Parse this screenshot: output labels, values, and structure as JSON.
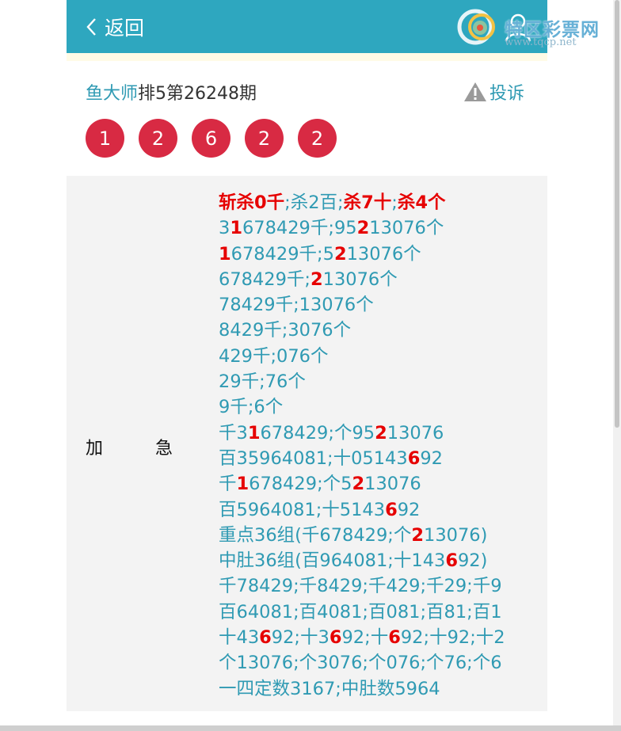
{
  "header": {
    "back_label": "返回"
  },
  "watermark": {
    "text": "特区彩票网",
    "url": "www.tqcp.net"
  },
  "title": {
    "author": "鱼大师",
    "rest": "排5第26248期"
  },
  "complain_label": "投诉",
  "balls": [
    "1",
    "2",
    "6",
    "2",
    "2"
  ],
  "label": {
    "a": "加",
    "b": "急"
  },
  "lines": [
    [
      [
        "斩杀0千",
        1
      ],
      [
        ";杀2百;",
        0
      ],
      [
        "杀7十",
        1
      ],
      [
        ";",
        0
      ],
      [
        "杀4个",
        1
      ]
    ],
    [
      [
        "3",
        0
      ],
      [
        "1",
        1
      ],
      [
        "678429千;95",
        0
      ],
      [
        "2",
        1
      ],
      [
        "13076个",
        0
      ]
    ],
    [
      [
        "1",
        1
      ],
      [
        "678429千;5",
        0
      ],
      [
        "2",
        1
      ],
      [
        "13076个",
        0
      ]
    ],
    [
      [
        "678429千;",
        0
      ],
      [
        "2",
        1
      ],
      [
        "13076个",
        0
      ]
    ],
    [
      [
        "78429千;13076个",
        0
      ]
    ],
    [
      [
        "8429千;3076个",
        0
      ]
    ],
    [
      [
        "429千;076个",
        0
      ]
    ],
    [
      [
        "29千;76个",
        0
      ]
    ],
    [
      [
        "9千;6个",
        0
      ]
    ],
    [
      [
        "千3",
        0
      ],
      [
        "1",
        1
      ],
      [
        "678429;个95",
        0
      ],
      [
        "2",
        1
      ],
      [
        "13076",
        0
      ]
    ],
    [
      [
        "百35964081;十05143",
        0
      ],
      [
        "6",
        1
      ],
      [
        "92",
        0
      ]
    ],
    [
      [
        "千",
        0
      ],
      [
        "1",
        1
      ],
      [
        "678429;个5",
        0
      ],
      [
        "2",
        1
      ],
      [
        "13076",
        0
      ]
    ],
    [
      [
        "百5964081;十5143",
        0
      ],
      [
        "6",
        1
      ],
      [
        "92",
        0
      ]
    ],
    [
      [
        "重点36组(千678429;个",
        0
      ],
      [
        "2",
        1
      ],
      [
        "13076)",
        0
      ]
    ],
    [
      [
        "中肚36组(百964081;十143",
        0
      ],
      [
        "6",
        1
      ],
      [
        "92)",
        0
      ]
    ],
    [
      [
        "千78429;千8429;千429;千29;千9",
        0
      ]
    ],
    [
      [
        "百64081;百4081;百081;百81;百1",
        0
      ]
    ],
    [
      [
        "十43",
        0
      ],
      [
        "6",
        1
      ],
      [
        "92;十3",
        0
      ],
      [
        "6",
        1
      ],
      [
        "92;十",
        0
      ],
      [
        "6",
        1
      ],
      [
        "92;十92;十2",
        0
      ]
    ],
    [
      [
        "个13076;个3076;个076;个76;个6",
        0
      ]
    ],
    [
      [
        "一四定数3167;中肚数5964",
        0
      ]
    ]
  ],
  "colors": {
    "header": "#2ea7bf",
    "ball": "#d82a43",
    "text": "#2f9ab3",
    "highlight": "#e60000"
  }
}
